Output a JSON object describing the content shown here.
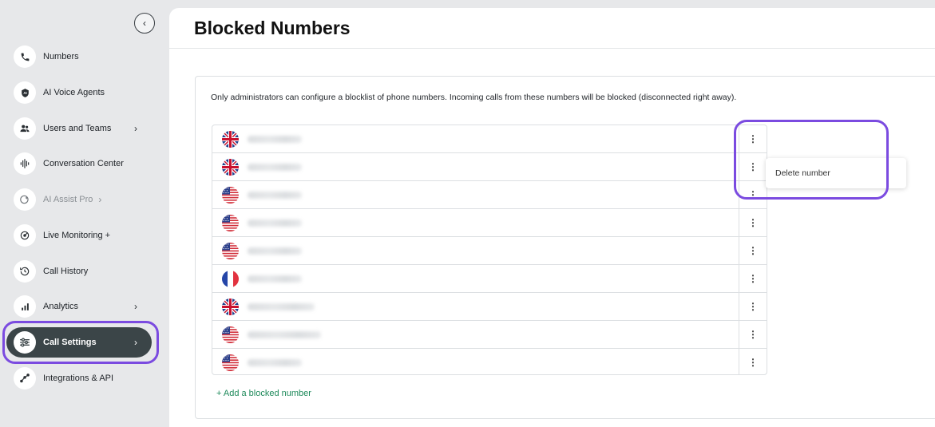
{
  "sidebar": {
    "items": [
      {
        "id": "numbers",
        "label": "Numbers",
        "icon": "phone-icon",
        "chevron": false,
        "state": "normal"
      },
      {
        "id": "ai-voice-agents",
        "label": "AI Voice Agents",
        "icon": "ai-agent-icon",
        "chevron": false,
        "state": "normal"
      },
      {
        "id": "users-and-teams",
        "label": "Users and Teams",
        "icon": "users-icon",
        "chevron": true,
        "state": "normal"
      },
      {
        "id": "conversation-center",
        "label": "Conversation Center",
        "icon": "waveform-icon",
        "chevron": false,
        "state": "normal"
      },
      {
        "id": "ai-assist-pro",
        "label": "AI Assist Pro",
        "icon": "sparkle-icon",
        "chevron": true,
        "state": "disabled"
      },
      {
        "id": "live-monitoring",
        "label": "Live Monitoring +",
        "icon": "monitoring-icon",
        "chevron": false,
        "state": "normal"
      },
      {
        "id": "call-history",
        "label": "Call History",
        "icon": "history-icon",
        "chevron": false,
        "state": "normal"
      },
      {
        "id": "analytics",
        "label": "Analytics",
        "icon": "bar-chart-icon",
        "chevron": true,
        "state": "normal"
      },
      {
        "id": "call-settings",
        "label": "Call Settings",
        "icon": "sliders-icon",
        "chevron": true,
        "state": "active"
      },
      {
        "id": "integrations-api",
        "label": "Integrations & API",
        "icon": "integrations-icon",
        "chevron": false,
        "state": "normal"
      }
    ],
    "chevron_glyph": "›",
    "collapse_glyph": "‹"
  },
  "page": {
    "title": "Blocked Numbers",
    "description": "Only administrators can configure a blocklist of phone numbers. Incoming calls from these numbers will be blocked (disconnected right away).",
    "add_link": "+ Add a blocked number"
  },
  "blocked_numbers": [
    {
      "flag": "uk",
      "number_blurred": true
    },
    {
      "flag": "uk",
      "number_blurred": true
    },
    {
      "flag": "us",
      "number_blurred": true
    },
    {
      "flag": "us",
      "number_blurred": true
    },
    {
      "flag": "us",
      "number_blurred": true
    },
    {
      "flag": "fr",
      "number_blurred": true
    },
    {
      "flag": "uk",
      "number_blurred": true
    },
    {
      "flag": "us",
      "number_blurred": true
    },
    {
      "flag": "us",
      "number_blurred": true
    }
  ],
  "row_menu": {
    "kebab_glyph": "⋮",
    "open_row": 0,
    "items": [
      "Delete number"
    ]
  },
  "colors": {
    "active_nav": "#3b4548",
    "highlight": "#7b4be0",
    "link": "#1f8a5b"
  }
}
